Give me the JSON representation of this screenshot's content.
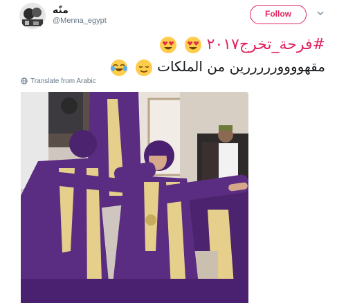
{
  "tweet": {
    "display_name": "منّه",
    "handle": "@Menna_egypt",
    "follow_label": "Follow",
    "hashtag_line": "#فرحة_تخرج٢٠١٧",
    "body_line": "مقهوووورررررين من الملكات",
    "translate_label": "Translate from Arabic",
    "line1_emojis": [
      "heart-eyes-emoji",
      "heart-eyes-emoji"
    ],
    "line2_emojis": [
      "relieved-emoji",
      "tears-of-joy-emoji"
    ]
  },
  "colors": {
    "follow_accent": "#e0245e",
    "hashtag": "#e0245e",
    "secondary_text": "#657786",
    "gown_purple": "#5b2d82",
    "stole_gold": "#e6cf8a"
  },
  "media": {
    "icon": "graduation-photo"
  }
}
